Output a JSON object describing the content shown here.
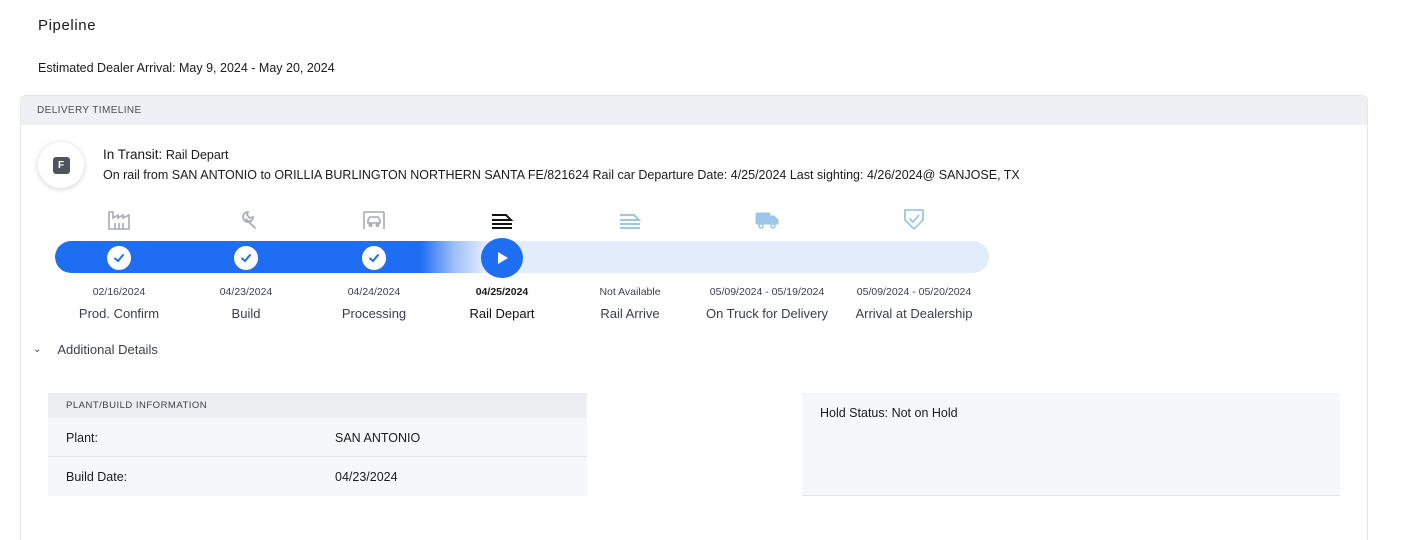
{
  "page_title": "Pipeline",
  "estimated_arrival": "Estimated Dealer Arrival: May 9, 2024 - May 20, 2024",
  "timeline": {
    "header": "DELIVERY TIMELINE",
    "avatar_letter": "F",
    "status_label": "In Transit:",
    "status_value": "Rail Depart",
    "status_detail": "On rail from SAN ANTONIO to ORILLIA BURLINGTON NORTHERN SANTA FE/821624 Rail car Departure Date: 4/25/2024 Last sighting: 4/26/2024@ SANJOSE, TX",
    "progress_color": "#1f6ef2",
    "stages": [
      {
        "icon": "factory-icon",
        "date": "02/16/2024",
        "name": "Prod. Confirm",
        "state": "completed"
      },
      {
        "icon": "wrench-icon",
        "date": "04/23/2024",
        "name": "Build",
        "state": "completed"
      },
      {
        "icon": "vehicle-lot-icon",
        "date": "04/24/2024",
        "name": "Processing",
        "state": "completed"
      },
      {
        "icon": "train-icon",
        "date": "04/25/2024",
        "name": "Rail Depart",
        "state": "current"
      },
      {
        "icon": "train-arrive-icon",
        "date": "Not Available",
        "name": "Rail Arrive",
        "state": "pending"
      },
      {
        "icon": "truck-icon",
        "date": "05/09/2024 - 05/19/2024",
        "name": "On Truck for Delivery",
        "state": "pending"
      },
      {
        "icon": "shield-check-icon",
        "date": "05/09/2024 - 05/20/2024",
        "name": "Arrival at Dealership",
        "state": "pending"
      }
    ]
  },
  "additional_details": {
    "label": "Additional Details",
    "plant_build": {
      "header": "PLANT/BUILD INFORMATION",
      "rows": [
        {
          "key": "Plant:",
          "value": "SAN ANTONIO"
        },
        {
          "key": "Build Date:",
          "value": "04/23/2024"
        }
      ]
    },
    "hold_status": "Hold Status: Not on Hold"
  }
}
